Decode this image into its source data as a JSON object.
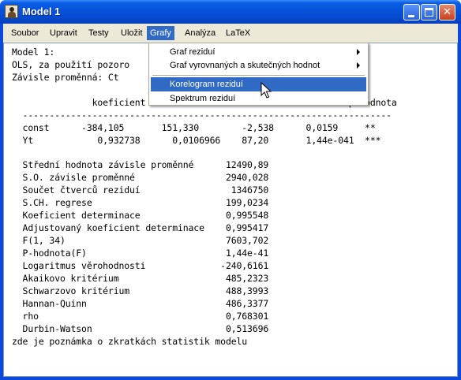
{
  "window": {
    "title": "Model 1"
  },
  "menubar": [
    {
      "label": "Soubor"
    },
    {
      "label": "Upravit"
    },
    {
      "label": "Testy"
    },
    {
      "label": "Uložit"
    },
    {
      "label": "Grafy"
    },
    {
      "label": "Analýza"
    },
    {
      "label": "LaTeX"
    }
  ],
  "dropdown": {
    "items": [
      {
        "label": "Graf reziduí"
      },
      {
        "label": "Graf vyrovnaných a skutečných hodnot"
      },
      {
        "label": "Korelogram reziduí"
      },
      {
        "label": "Spektrum reziduí"
      }
    ]
  },
  "output": {
    "lines": [
      "Model 1:",
      "OLS, za použití pozoro",
      "Závisle proměnná: Ct",
      "",
      "               koeficient                                      p-hodnota",
      "  ---------------------------------------------------------------------",
      "  const      -384,105       151,330        -2,538      0,0159     **",
      "  Yt            0,932738      0,0106966    87,20       1,44e-041  ***",
      "",
      "  Střední hodnota závisle proměnné      12490,89",
      "  S.O. závisle proměnné                 2940,028",
      "  Součet čtverců reziduí                 1346750",
      "  S.CH. regrese                         199,0234",
      "  Koeficient determinace                0,995548",
      "  Adjustovaný koeficient determinace    0,995417",
      "  F(1, 34)                              7603,702",
      "  P-hodnota(F)                          1,44e-41",
      "  Logaritmus věrohodnosti              -240,6161",
      "  Akaikovo kritérium                    485,2323",
      "  Schwarzovo kritérium                  488,3993",
      "  Hannan-Quinn                          486,3377",
      "  rho                                   0,768301",
      "  Durbin-Watson                         0,513696",
      "zde je poznámka o zkratkách statistik modelu"
    ]
  }
}
